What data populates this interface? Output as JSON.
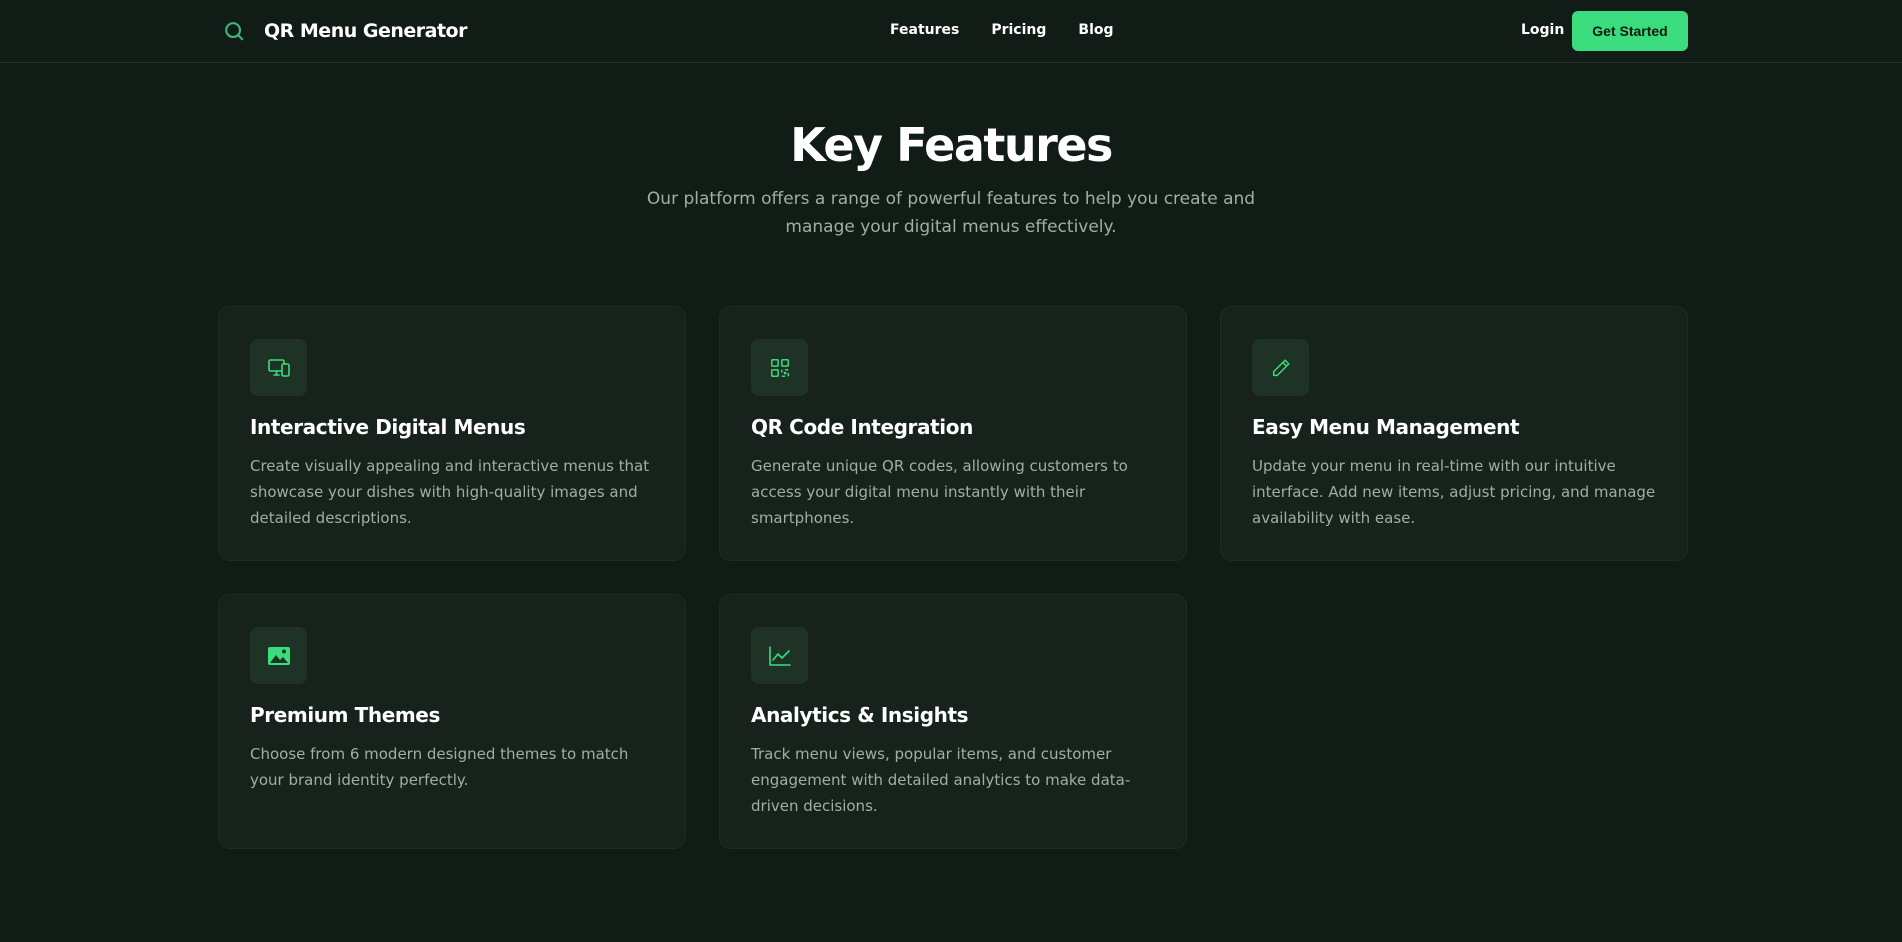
{
  "nav": {
    "brand": "QR Menu Generator",
    "links": [
      "Features",
      "Pricing",
      "Blog"
    ],
    "login": "Login",
    "cta": "Get Started"
  },
  "hero": {
    "title": "Key Features",
    "subtitle": "Our platform offers a range of powerful features to help you create and manage your digital menus effectively."
  },
  "features": [
    {
      "icon": "devices-icon",
      "title": "Interactive Digital Menus",
      "description": "Create visually appealing and interactive menus that showcase your dishes with high-quality images and detailed descriptions."
    },
    {
      "icon": "qr-code-icon",
      "title": "QR Code Integration",
      "description": "Generate unique QR codes, allowing customers to access your digital menu instantly with their smartphones."
    },
    {
      "icon": "pencil-icon",
      "title": "Easy Menu Management",
      "description": "Update your menu in real-time with our intuitive interface. Add new items, adjust pricing, and manage availability with ease."
    },
    {
      "icon": "image-icon",
      "title": "Premium Themes",
      "description": "Choose from 6 modern designed themes to match your brand identity perfectly."
    },
    {
      "icon": "chart-icon",
      "title": "Analytics & Insights",
      "description": "Track menu views, popular items, and customer engagement with detailed analytics to make data-driven decisions."
    }
  ],
  "colors": {
    "background": "#121c16",
    "card": "#16221b",
    "accent": "#3bdc7e",
    "muted_text": "#a2ada6"
  }
}
